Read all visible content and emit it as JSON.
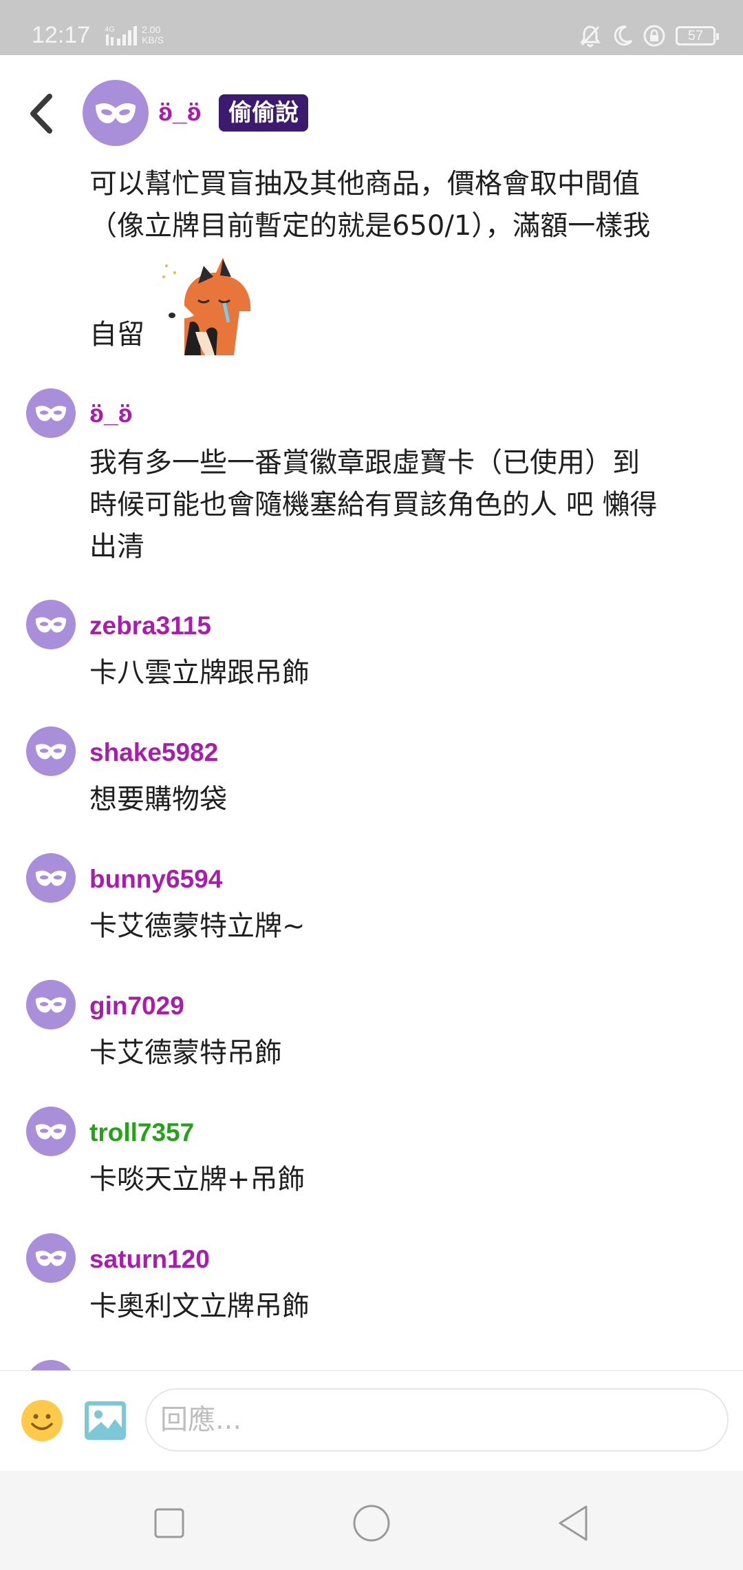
{
  "status_bar": {
    "time": "12:17",
    "network": "4G",
    "speed_value": "2.00",
    "speed_unit": "KB/S",
    "battery": "57"
  },
  "header": {
    "author": "ʚ̈_ʚ̈",
    "badge": "偷偷說"
  },
  "messages": [
    {
      "lines": [
        "可以幫忙買盲抽及其他商品，價格會取中間值",
        "（像立牌目前暫定的就是650/1），滿額一樣我",
        "自留"
      ],
      "sticker": "fox-crying-sticker"
    },
    {
      "user": "ʚ̈_ʚ̈",
      "lines": [
        "我有多一些一番賞徽章跟虛寶卡（已使用）到",
        "時候可能也會隨機塞給有買該角色的人 吧 懶得",
        "出清"
      ]
    },
    {
      "user": "zebra3115",
      "lines": [
        "卡八雲立牌跟吊飾"
      ]
    },
    {
      "user": "shake5982",
      "lines": [
        "想要購物袋"
      ]
    },
    {
      "user": "bunny6594",
      "lines": [
        "卡艾德蒙特立牌~"
      ]
    },
    {
      "user": "gin7029",
      "lines": [
        "卡艾德蒙特吊飾"
      ]
    },
    {
      "user": "troll7357",
      "lines": [
        "卡啖天立牌+吊飾"
      ],
      "user_color": "#24a319"
    },
    {
      "user": "saturn120",
      "lines": [
        "卡奧利文立牌吊飾"
      ]
    }
  ],
  "reply": {
    "placeholder": "回應..."
  },
  "colors": {
    "username": "#a81dac",
    "username_green": "#24a319",
    "avatar": "#a98fd9",
    "badge": "#3c1a6e"
  },
  "icons": [
    "back-arrow-icon",
    "mask-icon",
    "emoji-icon",
    "image-icon",
    "square-icon",
    "circle-icon",
    "triangle-back-icon"
  ]
}
